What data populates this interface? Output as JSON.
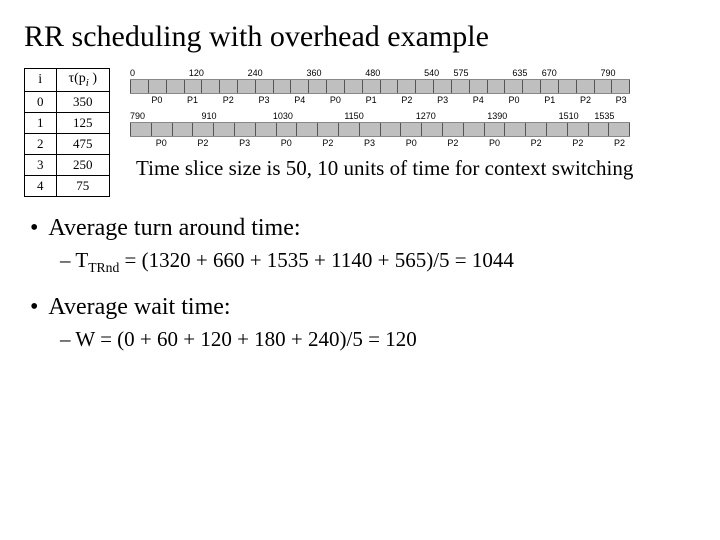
{
  "title": "RR scheduling with overhead example",
  "table": {
    "col_i": "i",
    "col_tau_pre": "τ(p",
    "col_tau_i": "i",
    "col_tau_post": " )",
    "rows": [
      {
        "i": "0",
        "tau": "350"
      },
      {
        "i": "1",
        "tau": "125"
      },
      {
        "i": "2",
        "tau": "475"
      },
      {
        "i": "3",
        "tau": "250"
      },
      {
        "i": "4",
        "tau": "75"
      }
    ]
  },
  "gantt": {
    "row1": {
      "ticks": [
        "0",
        "",
        "120",
        "",
        "240",
        "",
        "360",
        "",
        "480",
        "",
        "540",
        "575",
        "",
        "635",
        "670",
        "",
        "790"
      ],
      "labels": [
        "",
        "P0",
        "",
        "P1",
        "",
        "P2",
        "",
        "P3",
        "",
        "P4",
        "",
        "P0",
        "",
        "P1",
        "",
        "P2",
        "",
        "P3",
        "",
        "P4",
        "",
        "P0",
        "",
        "P1",
        "",
        "P2",
        "",
        "P3"
      ]
    },
    "row2": {
      "ticks": [
        "790",
        "",
        "910",
        "",
        "1030",
        "",
        "1150",
        "",
        "1270",
        "",
        "1390",
        "",
        "1510",
        "1535"
      ],
      "labels": [
        "",
        "P0",
        "",
        "P2",
        "",
        "P3",
        "",
        "P0",
        "",
        "P2",
        "",
        "P3",
        "",
        "P0",
        "",
        "P2",
        "",
        "P0",
        "",
        "P2",
        "",
        "P2",
        "",
        "P2"
      ]
    }
  },
  "chart_data": {
    "type": "table",
    "description": "Round-robin with overhead Gantt chart. Quantum 50, context switch 10.",
    "processes": [
      {
        "id": "P0",
        "burst": 350
      },
      {
        "id": "P1",
        "burst": 125
      },
      {
        "id": "P2",
        "burst": 475
      },
      {
        "id": "P3",
        "burst": 250
      },
      {
        "id": "P4",
        "burst": 75
      }
    ],
    "quantum": 50,
    "context_switch_overhead": 10,
    "row1_tick_values": [
      0,
      120,
      240,
      360,
      480,
      540,
      575,
      635,
      670,
      790
    ],
    "row1_order": [
      "P0",
      "P1",
      "P2",
      "P3",
      "P4",
      "P0",
      "P1",
      "P2",
      "P3",
      "P4",
      "P0",
      "P1",
      "P2",
      "P3"
    ],
    "row2_tick_values": [
      790,
      910,
      1030,
      1150,
      1270,
      1390,
      1510,
      1535
    ],
    "row2_order": [
      "P0",
      "P2",
      "P3",
      "P0",
      "P2",
      "P3",
      "P0",
      "P2",
      "P0",
      "P2",
      "P2",
      "P2"
    ]
  },
  "note": "Time slice size is 50, 10 units of time for context switching",
  "bullets": {
    "turnaround_label": "Average turn around time:",
    "turnaround_eq_pre": "T",
    "turnaround_eq_sub": "TRnd",
    "turnaround_eq_post": " = (1320 + 660 + 1535  + 1140 + 565)/5 = 1044",
    "wait_label": "Average wait time:",
    "wait_eq": "W = (0 + 60 + 120 + 180 + 240)/5 = 120"
  }
}
